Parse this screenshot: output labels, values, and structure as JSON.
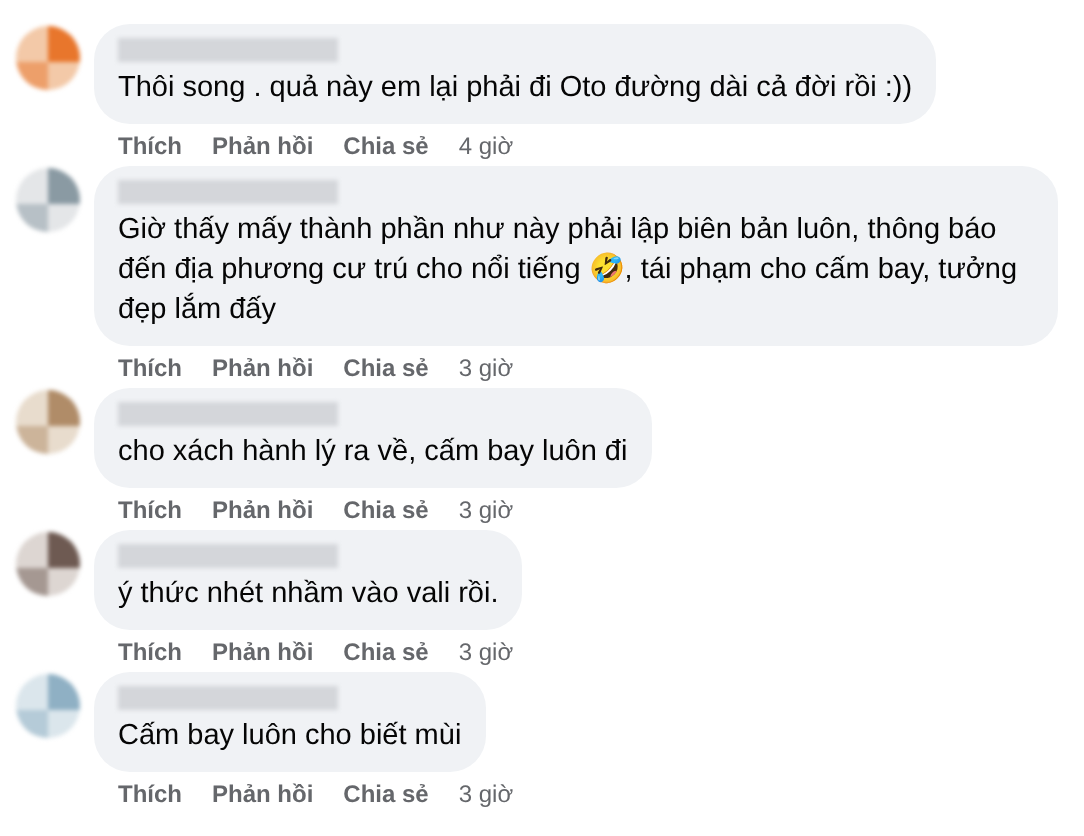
{
  "comments": [
    {
      "text": "Thôi song . quả này em lại phải đi Oto đường dài cả đời rồi :))",
      "actions": [
        "Thích",
        "Phản hồi",
        "Chia sẻ"
      ],
      "time": "4 giờ"
    },
    {
      "text": "Giờ thấy mấy thành phần như này phải lập biên bản luôn, thông báo đến địa phương cư trú cho nổi tiếng 🤣, tái phạm cho cấm bay, tưởng đẹp lắm đấy",
      "actions": [
        "Thích",
        "Phản hồi",
        "Chia sẻ"
      ],
      "time": "3 giờ"
    },
    {
      "text": "cho xách hành lý ra về, cấm bay luôn đi",
      "actions": [
        "Thích",
        "Phản hồi",
        "Chia sẻ"
      ],
      "time": "3 giờ"
    },
    {
      "text": "ý thức nhét nhầm vào vali rồi.",
      "actions": [
        "Thích",
        "Phản hồi",
        "Chia sẻ"
      ],
      "time": "3 giờ"
    },
    {
      "text": "Cấm bay luôn cho biết mùi",
      "actions": [
        "Thích",
        "Phản hồi",
        "Chia sẻ"
      ],
      "time": "3 giờ"
    }
  ]
}
